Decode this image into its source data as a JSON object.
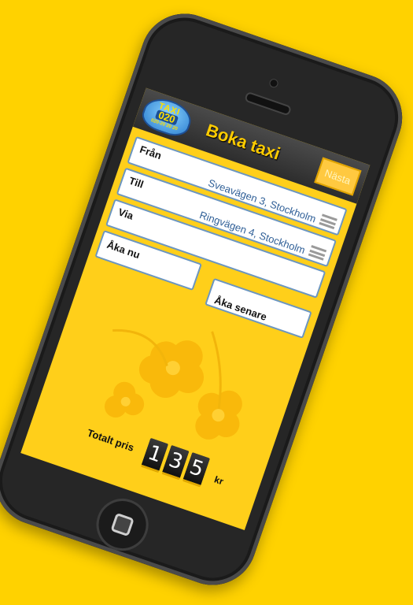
{
  "header": {
    "logo_word": "TAXI",
    "logo_number": "020",
    "logo_phone": "020-20 20 20",
    "title": "Boka taxi",
    "next_label": "Nästa"
  },
  "form": {
    "from": {
      "label": "Från",
      "value": "Sveavägen 3, Stockholm"
    },
    "to": {
      "label": "Till",
      "value": "Ringvägen 4, Stockholm"
    },
    "via": {
      "label": "Via",
      "value": ""
    },
    "now_label": "Åka nu",
    "later_label": "Åka senare"
  },
  "price": {
    "label": "Totalt pris",
    "digits": [
      "1",
      "3",
      "5"
    ],
    "currency": "kr"
  },
  "colors": {
    "background": "#ffd200",
    "screen": "#ffcf1a",
    "accent_blue": "#2f5f97",
    "title_yellow": "#ffcc00"
  },
  "icons": {
    "field_menu": "hamburger-icon",
    "home": "home-button-icon"
  }
}
